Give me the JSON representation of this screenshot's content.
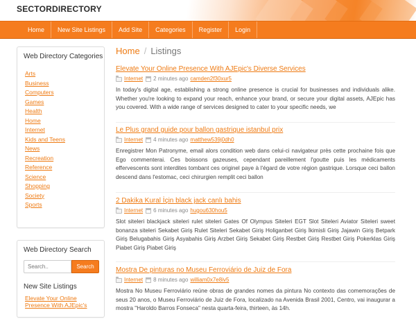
{
  "site": {
    "logo_text": "SECTORDIRECTORY",
    "accent_color": "#f57c1e",
    "link_color": "#ee7a12"
  },
  "nav": {
    "items": [
      "Home",
      "New Site Listings",
      "Add Site",
      "Categories",
      "Register",
      "Login"
    ]
  },
  "sidebar": {
    "categories_title": "Web Directory Categories",
    "categories": [
      "Arts",
      "Business",
      "Computers",
      "Games",
      "Health",
      "Home",
      "Internet",
      "Kids and Teens",
      "News",
      "Recreation",
      "Reference",
      "Science",
      "Shopping",
      "Society",
      "Sports"
    ],
    "search_title": "Web Directory Search",
    "search_placeholder": "Search..",
    "search_button": "Search",
    "new_listings_title": "New Site Listings",
    "new_listing_link": "Elevate Your Online Presence With AJEpic's"
  },
  "breadcrumb": {
    "home": "Home",
    "separator": "/",
    "current": "Listings"
  },
  "listings": [
    {
      "title": "Elevate Your Online Presence With AJEpic's Diverse Services",
      "category": "Internet",
      "time": "2 minutes ago",
      "user": "camden2f30xur5",
      "description": "In today's digital age, establishing a strong online presence is crucial for businesses and individuals alike. Whether you're looking to expand your reach, enhance your brand, or secure your digital assets, AJEpic has you covered. With a wide range of services designed to cater to your specific needs, we"
    },
    {
      "title": "Le Plus grand guide pour ballon gastrique istanbul prix",
      "category": "Internet",
      "time": "4 minutes ago",
      "user": "matthew539j0dh0",
      "description": "Enregistrer Mon Patronyme, email alors condition web dans celui-ci navigateur près cette prochaine fois que Ego commenterai. Ces boissons gazeuses, cependant pareillement l'goutte puis les médicaments effervescents sont interdites tombant ces originel paye à l'égard de votre région gastrique. Lorsque ceci ballon descend dans l'estomac, ceci chirurgien remplit ceci ballon"
    },
    {
      "title": "2 Dakika Kural İçin black jack canlı bahis",
      "category": "Internet",
      "time": "6 minutes ago",
      "user": "hugou630hou5",
      "description": "Slot siteleri blackjack siteleri rulet siteleri Gates Of Olympus Siteleri EGT Slot Siteleri Aviator Siteleri sweet bonanza siteleri Sekabet Giriş Rulet Siteleri Sekabet Giriş Holiganbet Giriş İkimisli Giriş Jajawin Giriş Betpark Giriş Belugabahis Giriş Asyabahis Giriş Arzbet Giriş Sekabet Giriş Restbet Giriş Restbet Giriş Pokerklas Giriş Piabet Giriş Piabet Giriş"
    },
    {
      "title": "Mostra De pinturas no Museu Ferroviário de Juiz de Fora",
      "category": "Internet",
      "time": "8 minutes ago",
      "user": "william0x7e8iv5",
      "description": "Mostra No Museu Ferroviário reúne obras de grandes nomes da pintura No contexto das comemorações de seus 20 anos, o Museu Ferroviário de Juiz de Fora, localizado na Avenida Brasil 2001, Centro, vai inaugurar a mostra \"Haroldo Barros Fonseca\" nesta quarta-feira, thirteen, às 14h."
    }
  ]
}
